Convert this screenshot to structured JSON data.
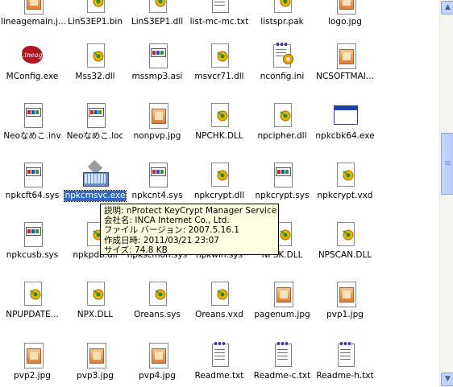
{
  "rows": [
    [
      {
        "label": "lineagemain.j...",
        "icon": "jpg"
      },
      {
        "label": "LinS3EP1.bin",
        "icon": "file"
      },
      {
        "label": "LinS3EP1.dll",
        "icon": "file"
      },
      {
        "label": "list-mc-mc.txt",
        "icon": "txt"
      },
      {
        "label": "listspr.pak",
        "icon": "file"
      },
      {
        "label": "logo.jpg",
        "icon": "jpg"
      }
    ],
    [
      {
        "label": "MConfig.exe",
        "icon": "lineage"
      },
      {
        "label": "Mss32.dll",
        "icon": "file"
      },
      {
        "label": "mssmp3.asi",
        "icon": "doc"
      },
      {
        "label": "msvcr71.dll",
        "icon": "file"
      },
      {
        "label": "nconfig.ini",
        "icon": "config"
      },
      {
        "label": "NCSOFTMAI...",
        "icon": "jpg"
      }
    ],
    [
      {
        "label": "Neoなめこ.inv",
        "icon": "doc"
      },
      {
        "label": "Neoなめこ.loc",
        "icon": "doc"
      },
      {
        "label": "nonpvp.jpg",
        "icon": "jpg"
      },
      {
        "label": "NPCHK.DLL",
        "icon": "file"
      },
      {
        "label": "npcipher.dll",
        "icon": "file"
      },
      {
        "label": "npkcbk64.exe",
        "icon": "exe"
      }
    ],
    [
      {
        "label": "npkcft64.sys",
        "icon": "doc"
      },
      {
        "label": "npkcmsvc.exe",
        "icon": "keyboard",
        "selected": true
      },
      {
        "label": "npkcnt4.sys",
        "icon": "doc"
      },
      {
        "label": "npkcrypt.dll",
        "icon": "file"
      },
      {
        "label": "npkcrypt.sys",
        "icon": "doc"
      },
      {
        "label": "npkcrypt.vxd",
        "icon": "file"
      }
    ],
    [
      {
        "label": "npkcusb.sys",
        "icon": "doc"
      },
      {
        "label": "npkpdb.dll",
        "icon": "file"
      },
      {
        "label": "npkscmon.sys",
        "icon": "doc"
      },
      {
        "label": "npkwin.sys",
        "icon": "doc"
      },
      {
        "label": "NPSK.DLL",
        "icon": "file"
      },
      {
        "label": "NPSCAN.DLL",
        "icon": "file"
      }
    ],
    [
      {
        "label": "NPUPDATE...",
        "icon": "file"
      },
      {
        "label": "NPX.DLL",
        "icon": "file"
      },
      {
        "label": "Oreans.sys",
        "icon": "file"
      },
      {
        "label": "Oreans.vxd",
        "icon": "file"
      },
      {
        "label": "pagenum.jpg",
        "icon": "jpg"
      },
      {
        "label": "pvp1.jpg",
        "icon": "jpg"
      }
    ],
    [
      {
        "label": "pvp2.jpg",
        "icon": "jpg"
      },
      {
        "label": "pvp3.jpg",
        "icon": "jpg"
      },
      {
        "label": "pvp4.jpg",
        "icon": "jpg"
      },
      {
        "label": "Readme.txt",
        "icon": "txt"
      },
      {
        "label": "Readme-c.txt",
        "icon": "txt"
      },
      {
        "label": "Readme-h.txt",
        "icon": "txt"
      }
    ]
  ],
  "tooltip": {
    "description": "説明: nProtect KeyCrypt Manager Service",
    "company": "会社名: INCA Internet Co., Ltd.",
    "version": "ファイル バージョン: 2007.5.16.1",
    "created": "作成日時: 2011/03/21 23:07",
    "size": "サイズ: 74.8 KB"
  },
  "scrollbar": {
    "up_arrow": "▲",
    "down_arrow": "▼"
  }
}
